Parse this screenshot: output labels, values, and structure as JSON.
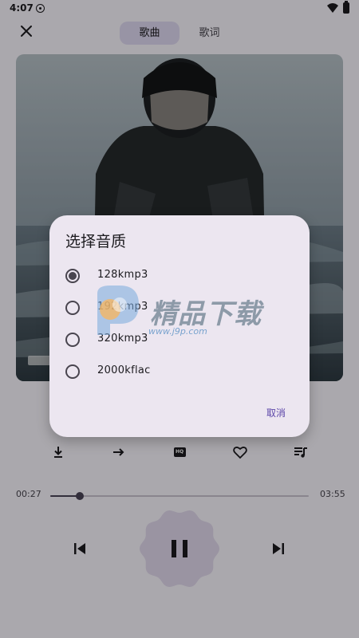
{
  "status_bar": {
    "time": "4:07"
  },
  "header": {
    "tabs": [
      {
        "label": "歌曲",
        "active": true
      },
      {
        "label": "歌词",
        "active": false
      }
    ]
  },
  "player": {
    "elapsed": "00:27",
    "duration": "03:55",
    "progress": 0.115,
    "hq_badge": "HQ",
    "state": "playing"
  },
  "dialog": {
    "title": "选择音质",
    "options": [
      {
        "label": "128kmp3",
        "selected": true
      },
      {
        "label": "192kmp3",
        "selected": false
      },
      {
        "label": "320kmp3",
        "selected": false
      },
      {
        "label": "2000kflac",
        "selected": false
      }
    ],
    "cancel_label": "取消"
  },
  "watermark": {
    "title": "精品下载",
    "url": "www.j9p.com"
  },
  "colors": {
    "accent": "#5b45a8",
    "dialog_bg": "#ece6f0",
    "tab_active_bg": "#e1dbf3",
    "play_button_bg": "#e3dbef"
  }
}
